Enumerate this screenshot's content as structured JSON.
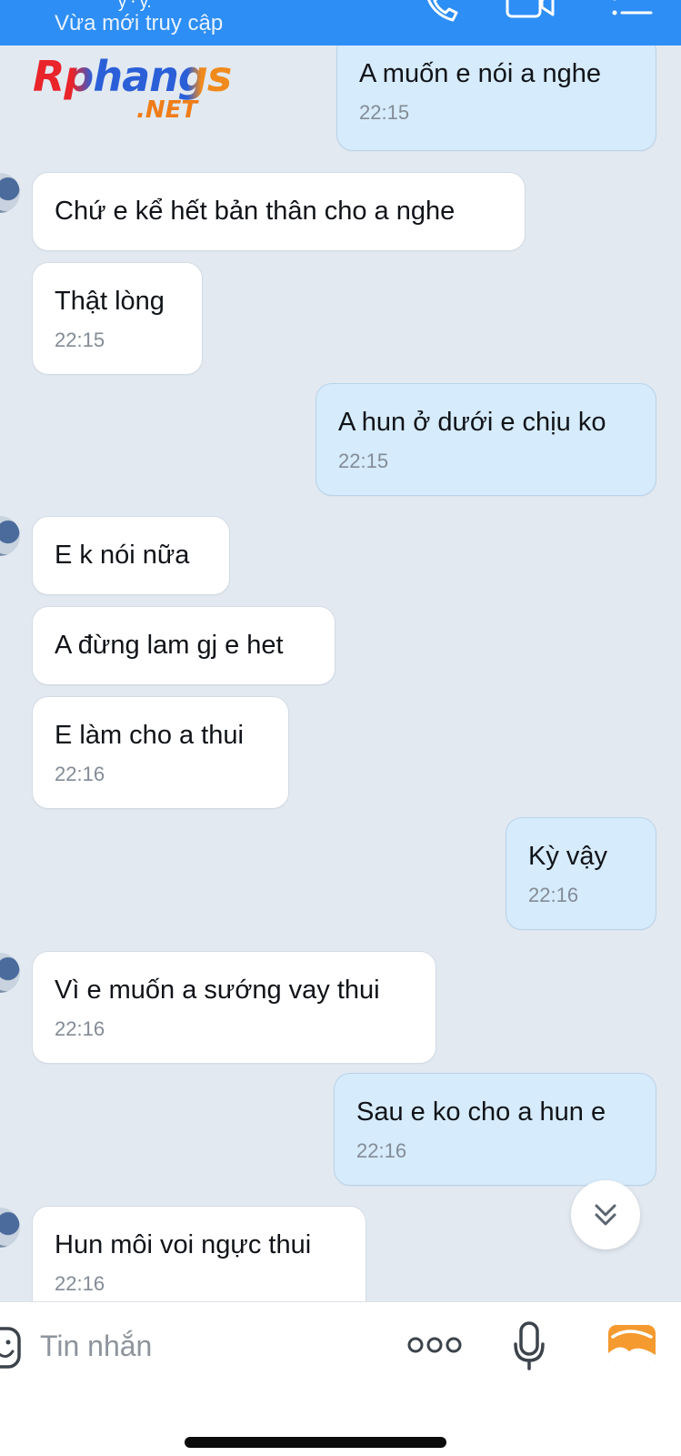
{
  "header": {
    "contact_name_fragment": "y ⸱ y.",
    "status": "Vừa mới truy cập",
    "icons": [
      "phone-icon",
      "video-call-icon",
      "menu-list-icon"
    ],
    "background_color": "#2d8ef5"
  },
  "watermark": {
    "brand": "Rphangs",
    "suffix": ".NET"
  },
  "messages": [
    {
      "direction": "out",
      "text": "A muốn e nói a nghe",
      "time": "22:15"
    },
    {
      "direction": "in",
      "text": "Chứ e kể hết bản thân cho a nghe",
      "time": ""
    },
    {
      "direction": "in",
      "text": "Thật lòng",
      "time": "22:15"
    },
    {
      "direction": "out",
      "text": "A hun ở dưới e chịu ko",
      "time": "22:15"
    },
    {
      "direction": "in",
      "text": "E k nói nữa",
      "time": ""
    },
    {
      "direction": "in",
      "text": "A đừng lam gj e het",
      "time": ""
    },
    {
      "direction": "in",
      "text": "E làm cho a thui",
      "time": "22:16"
    },
    {
      "direction": "out",
      "text": "Kỳ vậy",
      "time": "22:16"
    },
    {
      "direction": "in",
      "text": "Vì e muốn a sướng vay thui",
      "time": "22:16"
    },
    {
      "direction": "out",
      "text": "Sau e ko cho a hun e",
      "time": "22:16"
    },
    {
      "direction": "in",
      "text": "Hun môi voi ngực thui",
      "time": "22:16"
    }
  ],
  "composer": {
    "placeholder": "Tin nhắn",
    "icons": [
      "emoji-icon",
      "more-options-icon",
      "microphone-icon",
      "image-gallery-icon"
    ]
  },
  "colors": {
    "incoming_bubble": "#ffffff",
    "outgoing_bubble": "#d6ebfb",
    "chat_background": "#e2e9f1",
    "image_icon": "#f59a2e"
  }
}
